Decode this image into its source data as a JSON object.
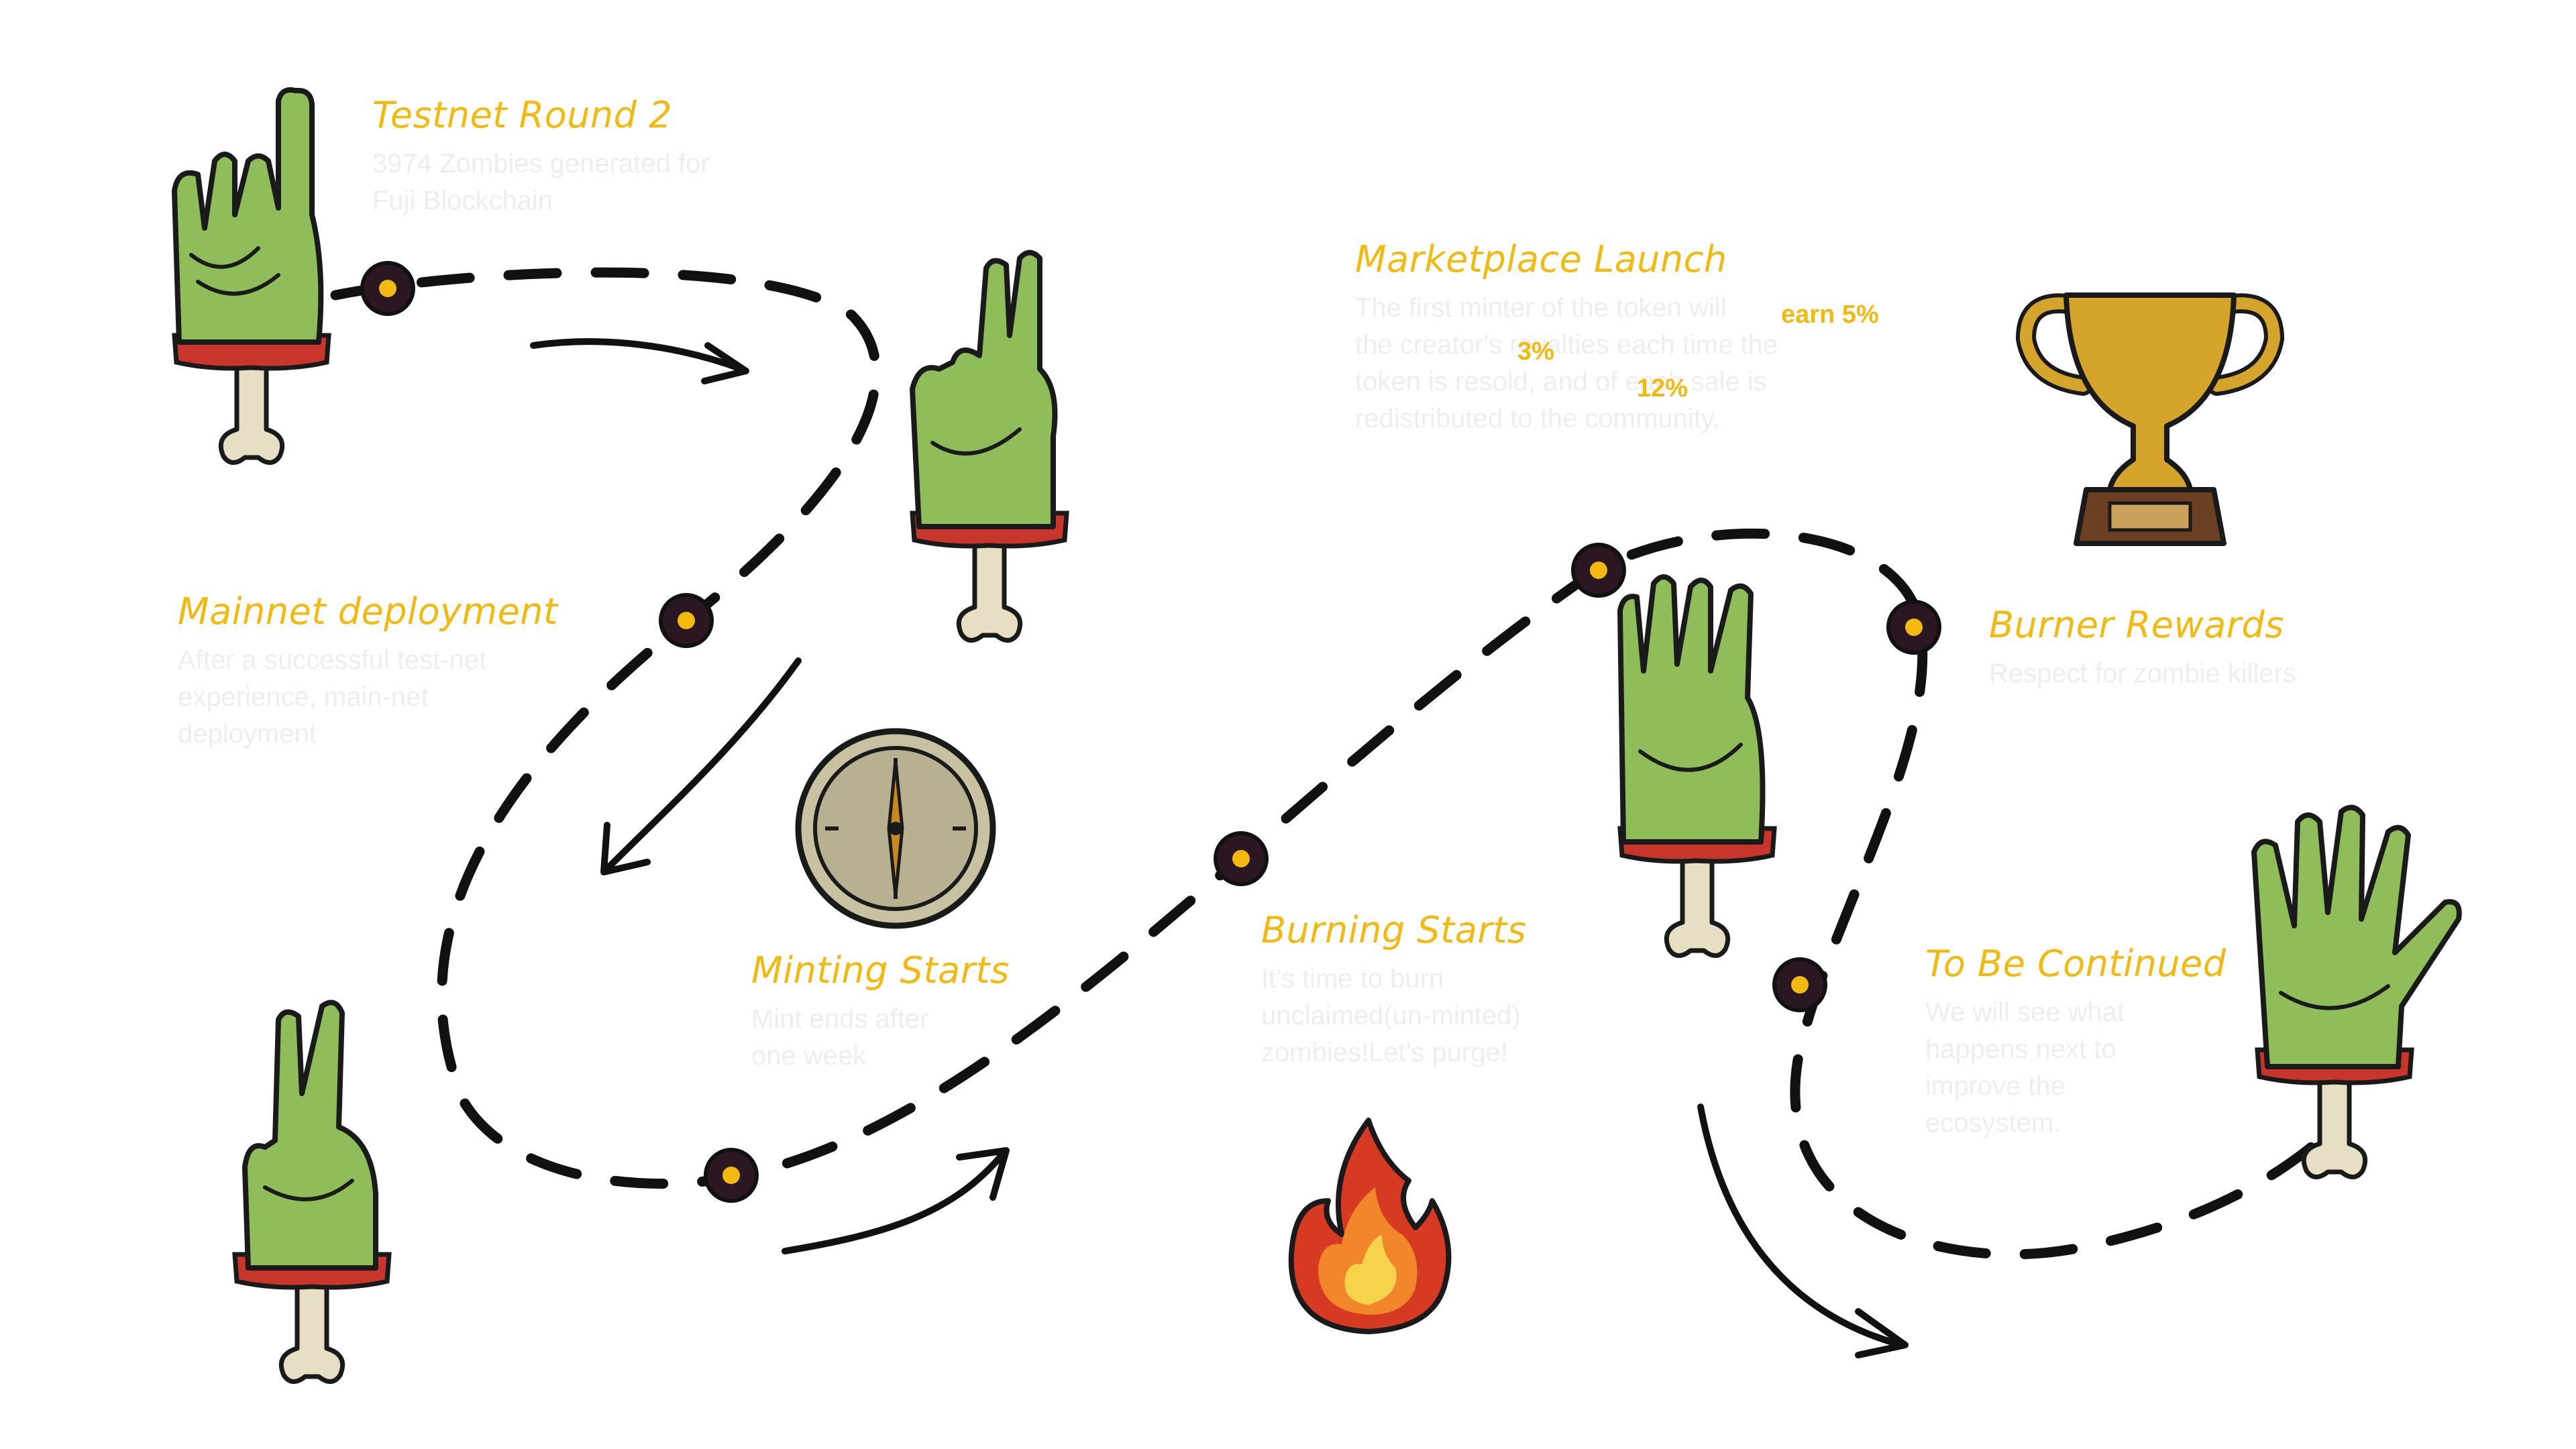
{
  "colors": {
    "accent": "#f2b90f",
    "description_text": "#eeeeee",
    "path_stroke": "#111111",
    "node_fill": "#2b1722",
    "node_center": "#f2b90f",
    "zombie_skin": "#8fbd5a",
    "zombie_wound": "#c8352b",
    "bone": "#e6dfc4"
  },
  "milestones": [
    {
      "id": "testnet-round-2",
      "title": "Testnet Round 2",
      "description": [
        "3974 Zombies generated for",
        "Fuji Blockchain"
      ],
      "icon": "zombie-hand-one-finger-icon"
    },
    {
      "id": "mainnet-deployment",
      "title": "Mainnet deployment",
      "description": [
        "After a successful test-net",
        "experience, main-net",
        "deployment"
      ],
      "icon": "zombie-hand-two-fingers-icon"
    },
    {
      "id": "minting-starts",
      "title": "Minting Starts",
      "description": [
        "Mint ends after",
        "one week"
      ],
      "icon": "clock-icon"
    },
    {
      "id": "burning-starts",
      "title": "Burning Starts",
      "description": [
        "It's time to burn",
        "unclaimed(un-minted)",
        "zombies!Let's purge!"
      ],
      "icon": "fire-icon"
    },
    {
      "id": "marketplace-launch",
      "title": "Marketplace Launch",
      "description": [
        "The first minter of the token will",
        "the creator's royalties each time the",
        "token is resold, and of each sale is",
        "redistributed to the community."
      ],
      "highlights": [
        "earn 5%",
        "3%",
        "12%"
      ],
      "icon": "zombie-hand-three-fingers-icon"
    },
    {
      "id": "burner-rewards",
      "title": "Burner Rewards",
      "description": [
        "Respect for zombie killers"
      ],
      "icon": "trophy-icon"
    },
    {
      "id": "to-be-continued",
      "title": "To Be Continued",
      "description": [
        "We will see what",
        "happens next to",
        "improve the",
        "ecosystem."
      ],
      "icon": "zombie-hand-open-icon"
    }
  ]
}
